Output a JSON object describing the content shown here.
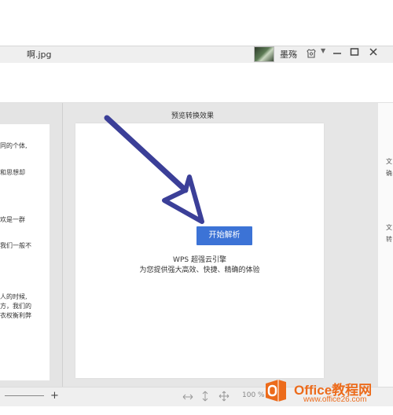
{
  "window": {
    "title": "啊.jpg",
    "user_name": "墨殇",
    "icons": [
      "skin-icon",
      "chevron-down-icon",
      "minimize-icon",
      "maximize-icon",
      "close-icon"
    ]
  },
  "left_panel": {
    "lines": [
      "同的个体,",
      "和思想却",
      "欢是一群",
      "我们一般不",
      "人的时候,",
      "方，我们的",
      "衣权衡利弊"
    ],
    "zoom_in": "+"
  },
  "preview": {
    "title": "预览转换效果",
    "start_button": "开始解析",
    "engine_title": "WPS 超强云引擎",
    "engine_desc": "为您提供强大高效、快捷、精确的体验"
  },
  "right_edge": {
    "lines": [
      "文",
      "确",
      "文",
      "转"
    ]
  },
  "statusbar": {
    "icons": [
      "fit-width-icon",
      "fit-height-icon",
      "move-icon"
    ],
    "zoom": "100 %"
  },
  "watermark": {
    "brand": "Office教程网",
    "url": "www.office26.com"
  },
  "colors": {
    "accent": "#3c73d6",
    "arrow": "#3b3f98",
    "watermark": "#ec6b1b"
  }
}
